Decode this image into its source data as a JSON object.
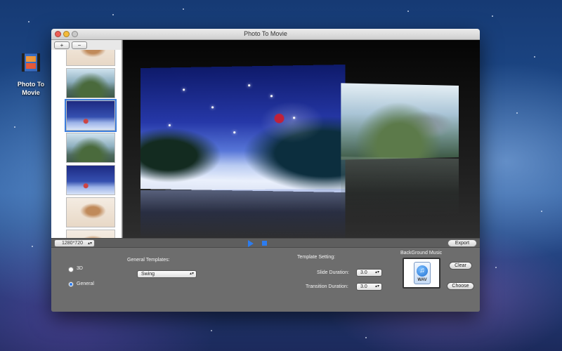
{
  "desktop": {
    "icon_label_line1": "Photo To",
    "icon_label_line2": "Movie"
  },
  "window": {
    "title": "Photo To Movie"
  },
  "sidebar": {
    "add_label": "+",
    "remove_label": "−"
  },
  "controls": {
    "resolution": "1280*720",
    "export_label": "Export"
  },
  "settings": {
    "mode_3d_label": "3D",
    "mode_general_label": "General",
    "selected_mode": "General",
    "general_templates_label": "General Templates:",
    "template_value": "Swing",
    "template_setting_label": "Template Setting:",
    "slide_duration_label": "Slide Duration:",
    "slide_duration_value": "3.0",
    "transition_duration_label": "Transition Duration:",
    "transition_duration_value": "3.0",
    "background_music_label": "BackGround Music",
    "music_file_type": "WAV",
    "clear_label": "Clear",
    "choose_label": "Choose"
  },
  "colors": {
    "accent": "#2b7cf0"
  }
}
